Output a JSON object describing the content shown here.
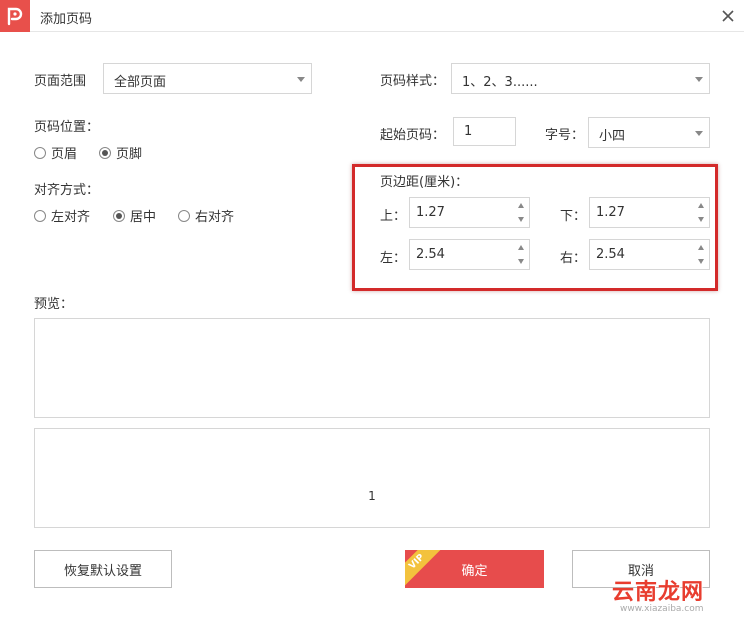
{
  "window": {
    "title": "添加页码"
  },
  "icons": {
    "logo": "app-logo-icon",
    "close": "close-icon"
  },
  "colors": {
    "accent": "#e74c4c",
    "highlight": "#d32a2a",
    "vip": "#f3c23d"
  },
  "page_range": {
    "label": "页面范围",
    "value": "全部页面"
  },
  "page_style": {
    "label": "页码样式：",
    "value": "1、2、3......"
  },
  "page_position": {
    "label": "页码位置：",
    "options": [
      {
        "label": "页眉",
        "selected": false
      },
      {
        "label": "页脚",
        "selected": true
      }
    ]
  },
  "start_page": {
    "label": "起始页码：",
    "value": "1"
  },
  "font_size": {
    "label": "字号：",
    "value": "小四"
  },
  "alignment": {
    "label": "对齐方式：",
    "options": [
      {
        "label": "左对齐",
        "selected": false
      },
      {
        "label": "居中",
        "selected": true
      },
      {
        "label": "右对齐",
        "selected": false
      }
    ]
  },
  "margins": {
    "label": "页边距(厘米)：",
    "top": {
      "label": "上：",
      "value": "1.27"
    },
    "bottom": {
      "label": "下：",
      "value": "1.27"
    },
    "left": {
      "label": "左：",
      "value": "2.54"
    },
    "right": {
      "label": "右：",
      "value": "2.54"
    }
  },
  "preview": {
    "label": "预览：",
    "page_number": "1"
  },
  "buttons": {
    "reset": "恢复默认设置",
    "ok": "确定",
    "vip": "VIP",
    "cancel": "取消"
  },
  "watermark": {
    "text": "云南龙网",
    "sub": "www.xiazaiba.com"
  }
}
